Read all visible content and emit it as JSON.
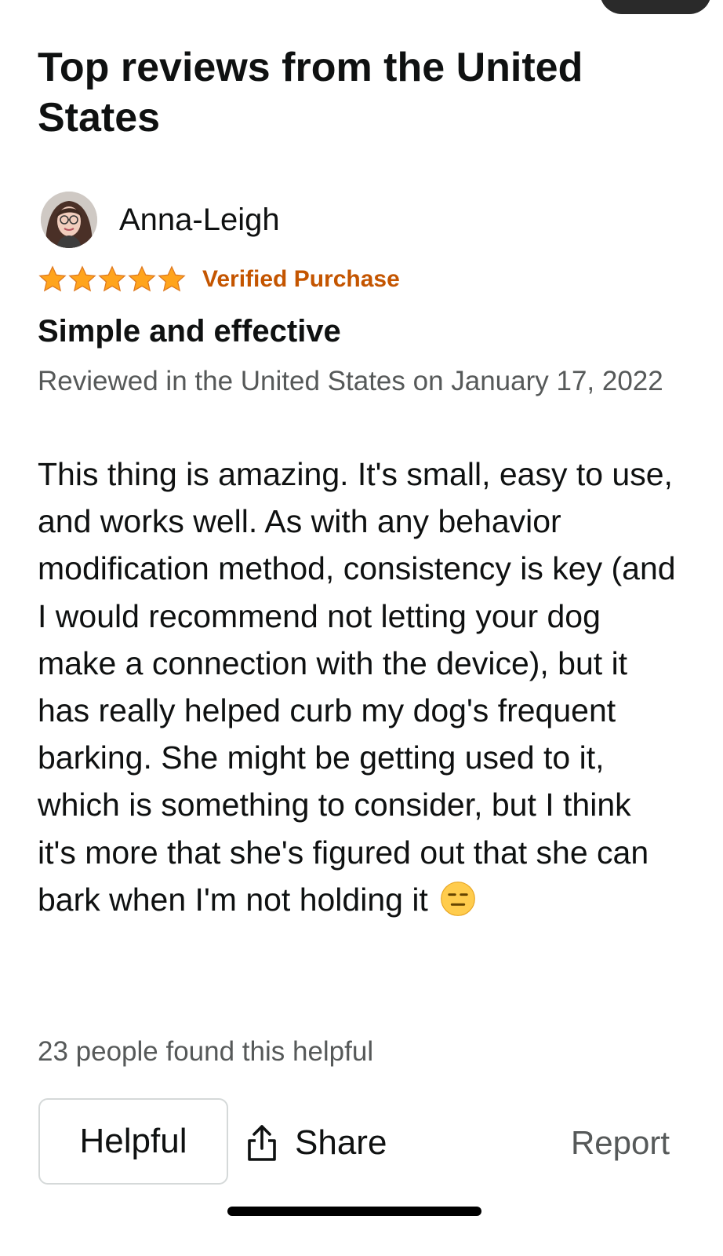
{
  "section": {
    "title": "Top reviews from the United States"
  },
  "review": {
    "reviewer_name": "Anna-Leigh",
    "rating": 5,
    "rating_max": 5,
    "verified_label": "Verified Purchase",
    "title": "Simple and effective",
    "date_line": "Reviewed in the United States on January 17, 2022",
    "body": "This thing is amazing. It's small, easy to use, and works well. As with any behavior modification method, consistency is key (and I would recommend not letting your dog make a connection with the device), but it has really helped curb my dog's frequent barking. She might be getting used to it, which is something to consider, but I think it's more that she's figured out that she can bark when I'm not holding it",
    "body_end_emoji": "expressionless-face-emoji",
    "helpful_count_text": "23 people found this helpful"
  },
  "actions": {
    "helpful_label": "Helpful",
    "share_label": "Share",
    "report_label": "Report"
  },
  "colors": {
    "star": "#ffa41c",
    "verified": "#c45500",
    "secondary_text": "#565959",
    "primary_text": "#0f1111",
    "button_border": "#d5d9d9"
  },
  "icons": {
    "share": "share-icon",
    "star": "star-icon",
    "avatar": "avatar"
  }
}
